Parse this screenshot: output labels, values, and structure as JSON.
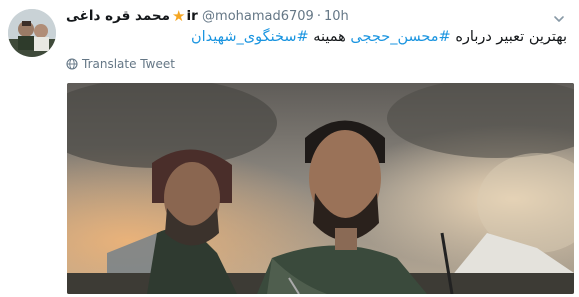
{
  "tweet": {
    "display_name": "محمد قره داغی",
    "name_suffix": "ir",
    "star_icon": "star-icon",
    "handle": "@mohamad6709",
    "separator": "·",
    "time": "10h",
    "text": {
      "before": "بهترین تعبیر درباره",
      "hashtag1": "#محسن_حججی",
      "middle": "همینه",
      "hashtag2": "#سخنگوی_شهیدان"
    },
    "translate_label": "Translate Tweet",
    "hashtag_color": "#1b95e0",
    "meta_color": "#657786"
  },
  "icons": {
    "avatar": "avatar",
    "chevron": "chevron-down-icon",
    "globe": "globe-icon"
  }
}
